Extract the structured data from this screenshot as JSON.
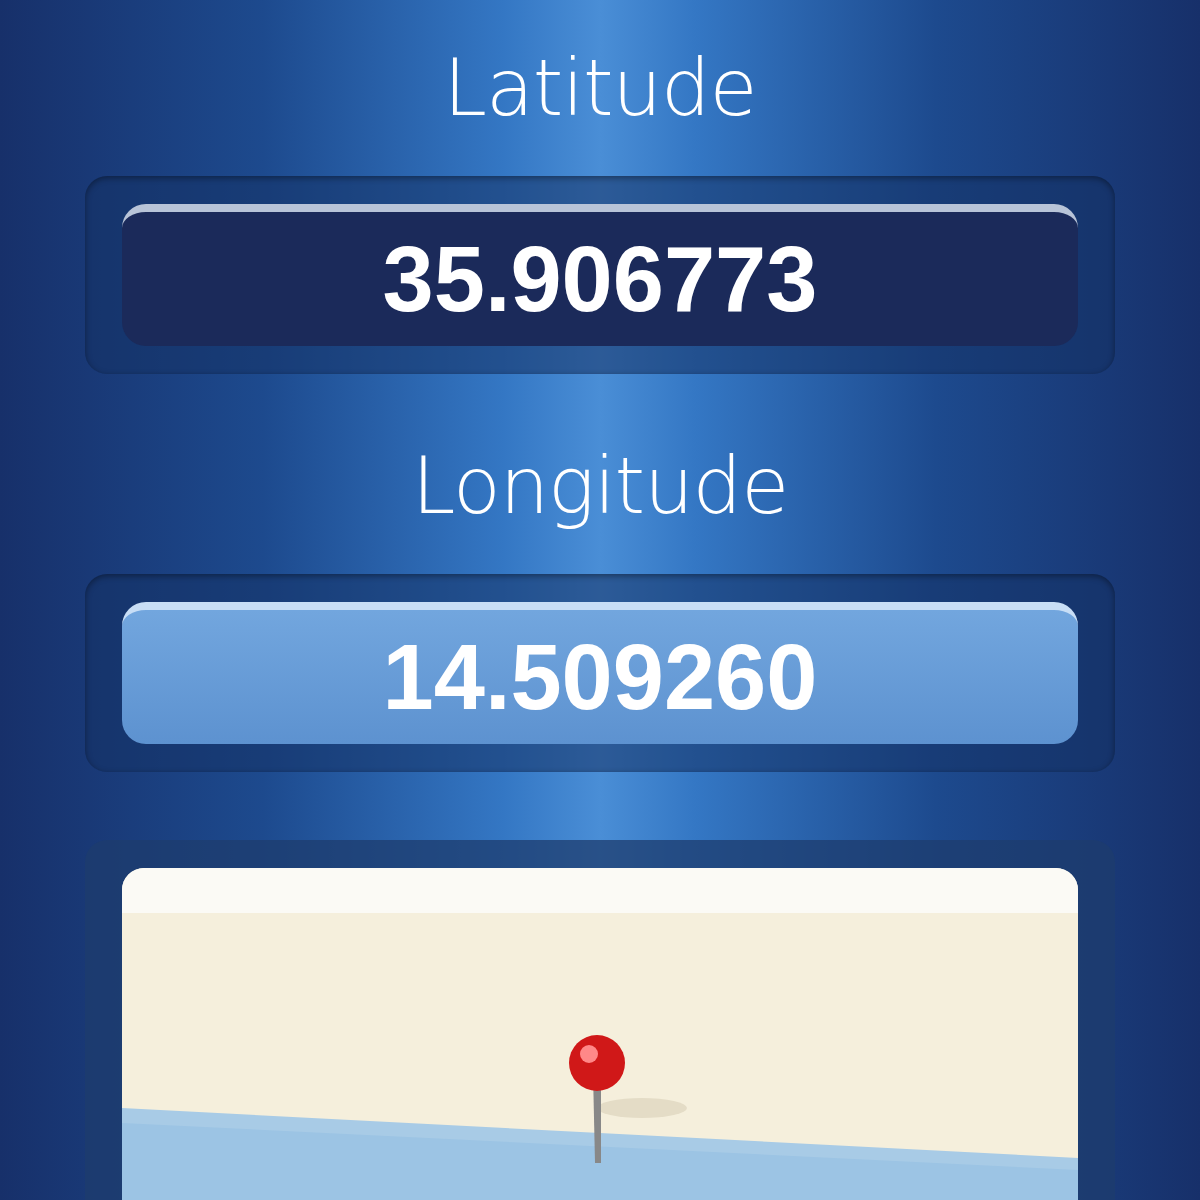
{
  "fields": [
    {
      "label": "Latitude",
      "value": "35.906773",
      "selected": false
    },
    {
      "label": "Longitude",
      "value": "14.509260",
      "selected": true
    }
  ]
}
